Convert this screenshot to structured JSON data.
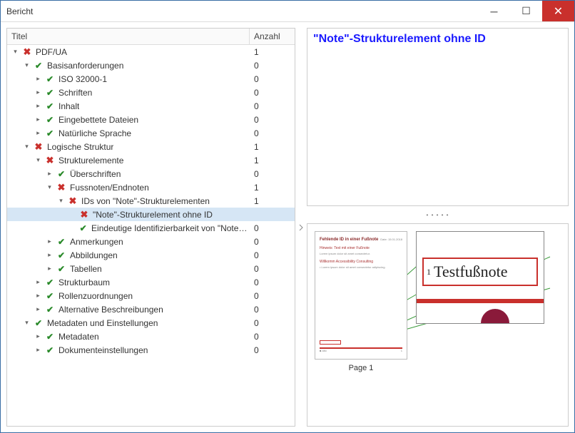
{
  "window": {
    "title": "Bericht"
  },
  "columns": {
    "title": "Titel",
    "count": "Anzahl"
  },
  "detail": {
    "title": "\"Note\"-Strukturelement ohne ID"
  },
  "preview": {
    "page_label": "Page 1",
    "doc_title": "Fehlende ID in einer Fußnote",
    "doc_date": "Date: 15.01.2018",
    "sec1": "Hinweis: Text mit einer Fußnote",
    "sec2": "Willkomm Accessibility Consulting",
    "footnote_text": "Testfußnote",
    "footnote_num": "1"
  },
  "tree": [
    {
      "indent": 0,
      "toggle": "▾",
      "status": "err",
      "label": "PDF/UA",
      "count": 1,
      "selected": false
    },
    {
      "indent": 1,
      "toggle": "▾",
      "status": "ok",
      "label": "Basisanforderungen",
      "count": 0,
      "selected": false
    },
    {
      "indent": 2,
      "toggle": "▸",
      "status": "ok",
      "label": "ISO 32000-1",
      "count": 0,
      "selected": false
    },
    {
      "indent": 2,
      "toggle": "▸",
      "status": "ok",
      "label": "Schriften",
      "count": 0,
      "selected": false
    },
    {
      "indent": 2,
      "toggle": "▸",
      "status": "ok",
      "label": "Inhalt",
      "count": 0,
      "selected": false
    },
    {
      "indent": 2,
      "toggle": "▸",
      "status": "ok",
      "label": "Eingebettete Dateien",
      "count": 0,
      "selected": false
    },
    {
      "indent": 2,
      "toggle": "▸",
      "status": "ok",
      "label": "Natürliche Sprache",
      "count": 0,
      "selected": false
    },
    {
      "indent": 1,
      "toggle": "▾",
      "status": "err",
      "label": "Logische Struktur",
      "count": 1,
      "selected": false
    },
    {
      "indent": 2,
      "toggle": "▾",
      "status": "err",
      "label": "Strukturelemente",
      "count": 1,
      "selected": false
    },
    {
      "indent": 3,
      "toggle": "▸",
      "status": "ok",
      "label": "Überschriften",
      "count": 0,
      "selected": false
    },
    {
      "indent": 3,
      "toggle": "▾",
      "status": "err",
      "label": "Fussnoten/Endnoten",
      "count": 1,
      "selected": false
    },
    {
      "indent": 4,
      "toggle": "▾",
      "status": "err",
      "label": "IDs von \"Note\"-Strukturelementen",
      "count": 1,
      "selected": false
    },
    {
      "indent": 5,
      "toggle": "",
      "status": "err",
      "label": "\"Note\"-Strukturelement ohne ID",
      "count": "",
      "selected": true
    },
    {
      "indent": 5,
      "toggle": "",
      "status": "ok",
      "label": "Eindeutige Identifizierbarkeit von \"Note\"-Str...",
      "count": 0,
      "selected": false
    },
    {
      "indent": 3,
      "toggle": "▸",
      "status": "ok",
      "label": "Anmerkungen",
      "count": 0,
      "selected": false
    },
    {
      "indent": 3,
      "toggle": "▸",
      "status": "ok",
      "label": "Abbildungen",
      "count": 0,
      "selected": false
    },
    {
      "indent": 3,
      "toggle": "▸",
      "status": "ok",
      "label": "Tabellen",
      "count": 0,
      "selected": false
    },
    {
      "indent": 2,
      "toggle": "▸",
      "status": "ok",
      "label": "Strukturbaum",
      "count": 0,
      "selected": false
    },
    {
      "indent": 2,
      "toggle": "▸",
      "status": "ok",
      "label": "Rollenzuordnungen",
      "count": 0,
      "selected": false
    },
    {
      "indent": 2,
      "toggle": "▸",
      "status": "ok",
      "label": "Alternative Beschreibungen",
      "count": 0,
      "selected": false
    },
    {
      "indent": 1,
      "toggle": "▾",
      "status": "ok",
      "label": "Metadaten und Einstellungen",
      "count": 0,
      "selected": false
    },
    {
      "indent": 2,
      "toggle": "▸",
      "status": "ok",
      "label": "Metadaten",
      "count": 0,
      "selected": false
    },
    {
      "indent": 2,
      "toggle": "▸",
      "status": "ok",
      "label": "Dokumenteinstellungen",
      "count": 0,
      "selected": false
    }
  ]
}
